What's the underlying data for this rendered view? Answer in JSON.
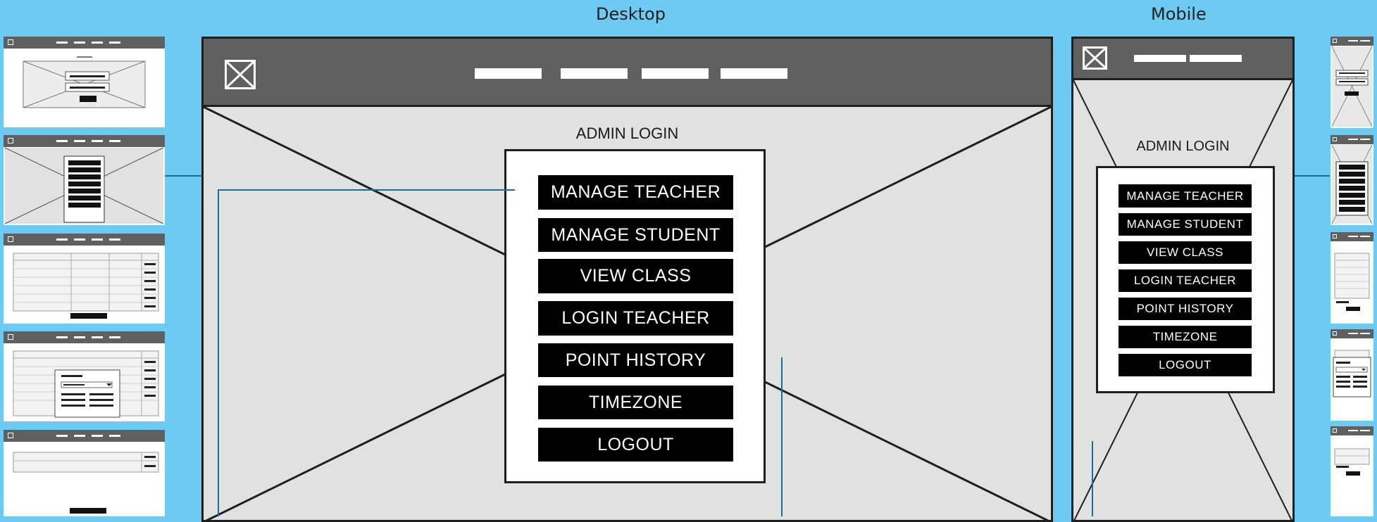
{
  "labels": {
    "desktop": "Desktop",
    "mobile": "Mobile"
  },
  "icons": {
    "logo": "image-placeholder-icon"
  },
  "colors": {
    "background": "#6dcbf3",
    "header": "#606060",
    "canvas": "#e1e1e1",
    "button": "#000000",
    "connector": "#1a6d96"
  },
  "desktop": {
    "title": "ADMIN LOGIN",
    "menu": [
      "MANAGE TEACHER",
      "MANAGE STUDENT",
      "VIEW CLASS",
      "LOGIN TEACHER",
      "POINT HISTORY",
      "TIMEZONE",
      "LOGOUT"
    ]
  },
  "mobile": {
    "title": "ADMIN LOGIN",
    "menu": [
      "MANAGE TEACHER",
      "MANAGE STUDENT",
      "VIEW CLASS",
      "LOGIN TEACHER",
      "POINT HISTORY",
      "TIMEZONE",
      "LOGOUT"
    ]
  }
}
